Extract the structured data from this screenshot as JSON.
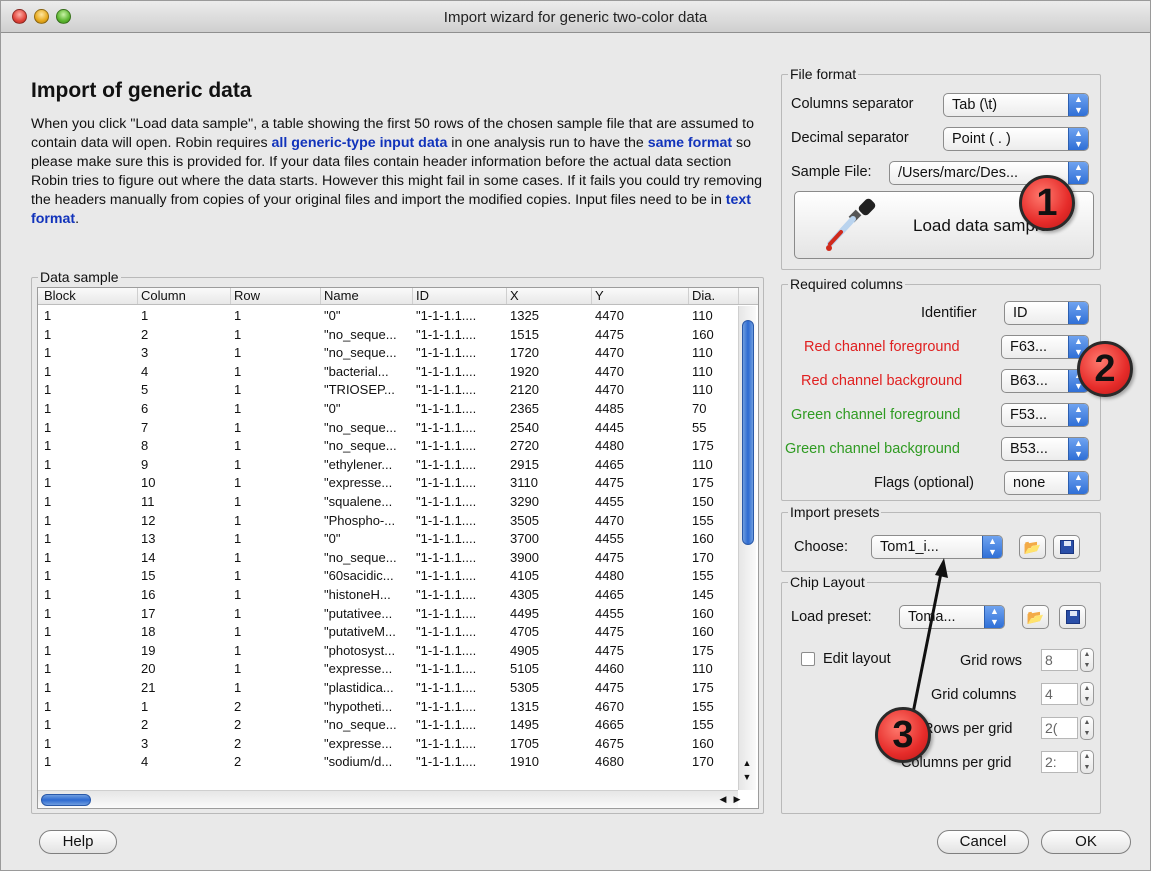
{
  "window": {
    "title": "Import wizard for generic two-color data"
  },
  "heading": "Import of generic data",
  "intro": {
    "p1": "When you click \"Load data sample\", a table showing the first 50 rows of the chosen sample file that are assumed to contain data will open. Robin requires ",
    "hl1": "all generic-type input data",
    "p2": " in one analysis run to have the ",
    "hl2": "same format",
    "p3": " so please make sure this is provided for. If your data files contain header information before the actual data section Robin tries to figure out where the data starts. However this might fail in some cases. If it fails you could try removing the headers manually from copies of your original files and import the modified copies. Input files need to be in ",
    "hl3": "text format",
    "p4": "."
  },
  "data_sample": {
    "legend": "Data sample",
    "columns": [
      "Block",
      "Column",
      "Row",
      "Name",
      "ID",
      "X",
      "Y",
      "Dia."
    ],
    "rows": [
      [
        "1",
        "1",
        "1",
        "\"0\"",
        "\"1-1-1.1....",
        "1325",
        "4470",
        "110"
      ],
      [
        "1",
        "2",
        "1",
        "\"no_seque...",
        "\"1-1-1.1....",
        "1515",
        "4475",
        "160"
      ],
      [
        "1",
        "3",
        "1",
        "\"no_seque...",
        "\"1-1-1.1....",
        "1720",
        "4470",
        "110"
      ],
      [
        "1",
        "4",
        "1",
        "\"bacterial...",
        "\"1-1-1.1....",
        "1920",
        "4470",
        "110"
      ],
      [
        "1",
        "5",
        "1",
        "\"TRIOSEP...",
        "\"1-1-1.1....",
        "2120",
        "4470",
        "110"
      ],
      [
        "1",
        "6",
        "1",
        "\"0\"",
        "\"1-1-1.1....",
        "2365",
        "4485",
        "70"
      ],
      [
        "1",
        "7",
        "1",
        "\"no_seque...",
        "\"1-1-1.1....",
        "2540",
        "4445",
        "55"
      ],
      [
        "1",
        "8",
        "1",
        "\"no_seque...",
        "\"1-1-1.1....",
        "2720",
        "4480",
        "175"
      ],
      [
        "1",
        "9",
        "1",
        "\"ethylener...",
        "\"1-1-1.1....",
        "2915",
        "4465",
        "110"
      ],
      [
        "1",
        "10",
        "1",
        "\"expresse...",
        "\"1-1-1.1....",
        "3110",
        "4475",
        "175"
      ],
      [
        "1",
        "11",
        "1",
        "\"squalene...",
        "\"1-1-1.1....",
        "3290",
        "4455",
        "150"
      ],
      [
        "1",
        "12",
        "1",
        "\"Phospho-...",
        "\"1-1-1.1....",
        "3505",
        "4470",
        "155"
      ],
      [
        "1",
        "13",
        "1",
        "\"0\"",
        "\"1-1-1.1....",
        "3700",
        "4455",
        "160"
      ],
      [
        "1",
        "14",
        "1",
        "\"no_seque...",
        "\"1-1-1.1....",
        "3900",
        "4475",
        "170"
      ],
      [
        "1",
        "15",
        "1",
        "\"60sacidic...",
        "\"1-1-1.1....",
        "4105",
        "4480",
        "155"
      ],
      [
        "1",
        "16",
        "1",
        "\"histoneH...",
        "\"1-1-1.1....",
        "4305",
        "4465",
        "145"
      ],
      [
        "1",
        "17",
        "1",
        "\"putativee...",
        "\"1-1-1.1....",
        "4495",
        "4455",
        "160"
      ],
      [
        "1",
        "18",
        "1",
        "\"putativeM...",
        "\"1-1-1.1....",
        "4705",
        "4475",
        "160"
      ],
      [
        "1",
        "19",
        "1",
        "\"photosyst...",
        "\"1-1-1.1....",
        "4905",
        "4475",
        "175"
      ],
      [
        "1",
        "20",
        "1",
        "\"expresse...",
        "\"1-1-1.1....",
        "5105",
        "4460",
        "110"
      ],
      [
        "1",
        "21",
        "1",
        "\"plastidica...",
        "\"1-1-1.1....",
        "5305",
        "4475",
        "175"
      ],
      [
        "1",
        "1",
        "2",
        "\"hypotheti...",
        "\"1-1-1.1....",
        "1315",
        "4670",
        "155"
      ],
      [
        "1",
        "2",
        "2",
        "\"no_seque...",
        "\"1-1-1.1....",
        "1495",
        "4665",
        "155"
      ],
      [
        "1",
        "3",
        "2",
        "\"expresse...",
        "\"1-1-1.1....",
        "1705",
        "4675",
        "160"
      ],
      [
        "1",
        "4",
        "2",
        "\"sodium/d...",
        "\"1-1-1.1....",
        "1910",
        "4680",
        "170"
      ]
    ]
  },
  "file_format": {
    "legend": "File format",
    "columns_separator_label": "Columns separator",
    "columns_separator_value": "Tab (\\t)",
    "decimal_separator_label": "Decimal separator",
    "decimal_separator_value": "Point ( . )",
    "sample_file_label": "Sample File:",
    "sample_file_value": "/Users/marc/Des...",
    "load_button": "Load data sample"
  },
  "required_columns": {
    "legend": "Required columns",
    "identifier_label": "Identifier",
    "identifier_value": "ID",
    "red_fg_label": "Red channel foreground",
    "red_fg_value": "F63...",
    "red_bg_label": "Red channel background",
    "red_bg_value": "B63...",
    "green_fg_label": "Green channel foreground",
    "green_fg_value": "F53...",
    "green_bg_label": "Green channel background",
    "green_bg_value": "B53...",
    "flags_label": "Flags (optional)",
    "flags_value": "none"
  },
  "import_presets": {
    "legend": "Import presets",
    "choose_label": "Choose:",
    "choose_value": "Tom1_i..."
  },
  "chip_layout": {
    "legend": "Chip Layout",
    "load_preset_label": "Load preset:",
    "load_preset_value": "Toma...",
    "edit_layout_label": "Edit layout",
    "grid_rows_label": "Grid rows",
    "grid_rows_value": "8",
    "grid_columns_label": "Grid columns",
    "grid_columns_value": "4",
    "rows_per_grid_label": "Rows per grid",
    "rows_per_grid_value": "2(",
    "columns_per_grid_label": "Columns per grid",
    "columns_per_grid_value": "2:"
  },
  "buttons": {
    "help": "Help",
    "cancel": "Cancel",
    "ok": "OK"
  },
  "annotations": [
    "1",
    "2",
    "3"
  ],
  "colors": {
    "accent_blue": "#2f6fd6",
    "red_label": "#e02020",
    "green_label": "#2f9b22",
    "highlight_text": "#1133bb",
    "badge_red": "#e62c2a"
  },
  "icons": [
    "pipette-icon",
    "folder-open-icon",
    "save-disk-icon",
    "arrow-up-icon"
  ]
}
